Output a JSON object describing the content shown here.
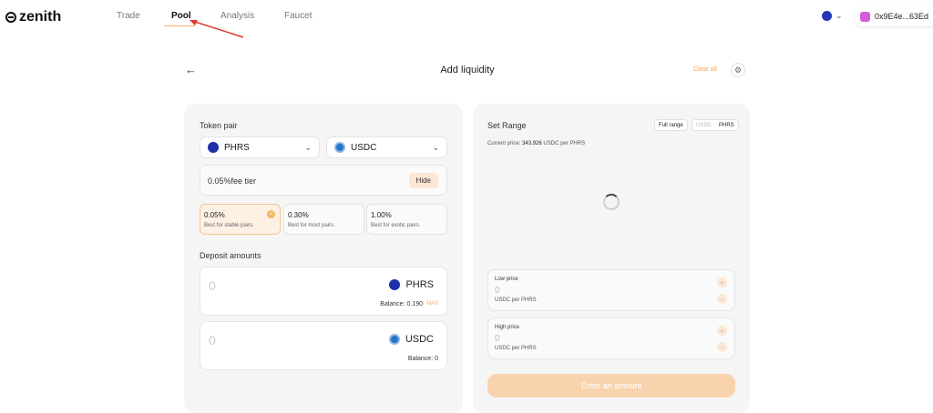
{
  "header": {
    "logo_text": "zenith",
    "nav": [
      {
        "label": "Trade",
        "active": false
      },
      {
        "label": "Pool",
        "active": true
      },
      {
        "label": "Analysis",
        "active": false
      },
      {
        "label": "Faucet",
        "active": false
      }
    ],
    "wallet_address": "0x9E4e...63Ed"
  },
  "page": {
    "title": "Add liquidity",
    "clear_all": "Clear all"
  },
  "token_pair": {
    "label": "Token pair",
    "token_a": "PHRS",
    "token_b": "USDC"
  },
  "fee": {
    "selected_text": "0.05%fee tier",
    "hide_label": "Hide",
    "tiers": [
      {
        "pct": "0.05%",
        "desc": "Best for stable pairs.",
        "selected": true
      },
      {
        "pct": "0.30%",
        "desc": "Best for most pairs.",
        "selected": false
      },
      {
        "pct": "1.00%",
        "desc": "Best for exotic pairs.",
        "selected": false
      }
    ]
  },
  "deposit": {
    "label": "Deposit amounts",
    "inputs": [
      {
        "amount": "0",
        "token": "PHRS",
        "balance": "Balance: 0.190",
        "max": "MAX"
      },
      {
        "amount": "0",
        "token": "USDC",
        "balance": "Balance: 0"
      }
    ]
  },
  "range": {
    "title": "Set Range",
    "full_range": "Full range",
    "toggle_options": [
      "USDC",
      "PHRS"
    ],
    "toggle_selected": "PHRS",
    "current_price_label": "Current price:",
    "current_price_value": "343.926",
    "current_price_unit": "USDC per PHRS",
    "low": {
      "label": "Low price",
      "value": "0",
      "unit": "USDC per PHRS"
    },
    "high": {
      "label": "High price",
      "value": "0",
      "unit": "USDC per PHRS"
    },
    "submit_label": "Enter an amount"
  },
  "colors": {
    "accent": "#f0a64a",
    "phrs": "#1e2fa8",
    "usdc": "#2775ca",
    "annotation_arrow": "#e03a2e"
  },
  "icons": [
    "back-arrow-icon",
    "gear-icon",
    "chevron-down-icon",
    "check-icon",
    "spinner-icon",
    "plus-icon",
    "minus-icon",
    "wallet-icon"
  ]
}
